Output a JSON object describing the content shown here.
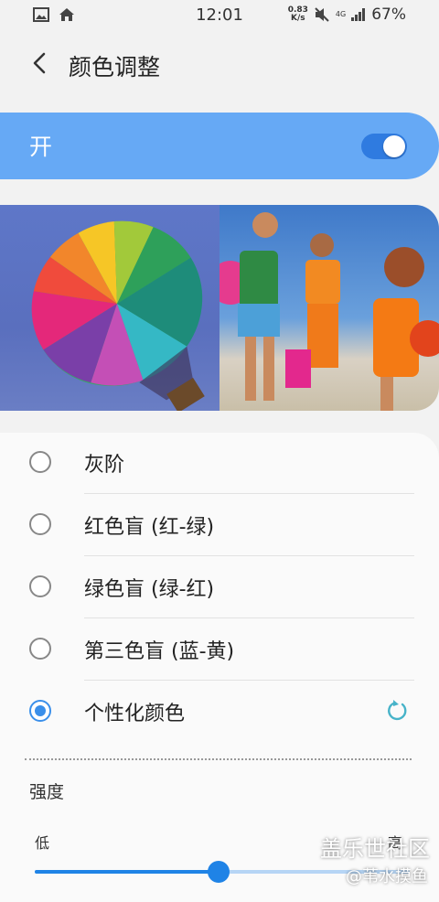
{
  "status_bar": {
    "time": "12:01",
    "net_speed_value": "0.83",
    "net_speed_unit": "K/s",
    "network_type": "4G",
    "battery": "67%",
    "icons": [
      "gallery-icon",
      "home-icon",
      "mute-icon",
      "signal-icon",
      "battery-icon"
    ]
  },
  "header": {
    "title": "颜色调整"
  },
  "master_switch": {
    "label": "开",
    "on": true
  },
  "preview": {
    "left": "hot-air-balloon-photo",
    "right": "beach-family-photo"
  },
  "options": [
    {
      "label": "灰阶",
      "selected": false
    },
    {
      "label": "红色盲 (红-绿)",
      "selected": false
    },
    {
      "label": "绿色盲 (绿-红)",
      "selected": false
    },
    {
      "label": "第三色盲 (蓝-黄)",
      "selected": false
    },
    {
      "label": "个性化颜色",
      "selected": true
    }
  ],
  "intensity": {
    "label": "强度",
    "low": "低",
    "high": "高",
    "value": 0.49
  },
  "watermark": {
    "brand": "盖乐世社区",
    "user": "@苇水摸鱼"
  },
  "colors": {
    "accent": "#1f83e6",
    "switch_bar": "#66a9f5"
  }
}
